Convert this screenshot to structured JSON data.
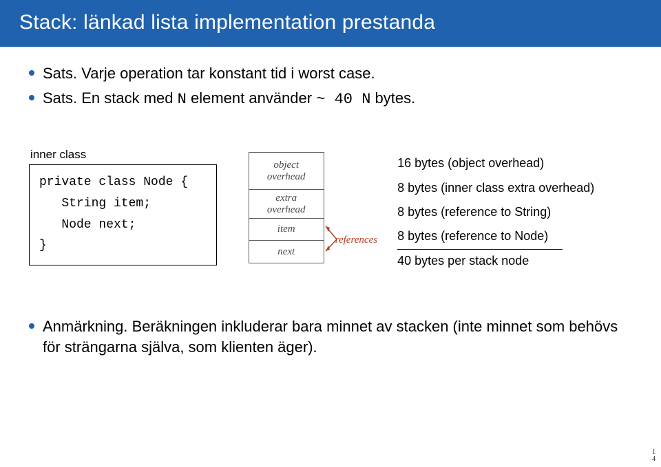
{
  "title": "Stack: länkad lista implementation prestanda",
  "bullets": {
    "b1_prefix": "Sats.",
    "b1_text": " Varje operation tar konstant tid i worst case.",
    "b2_prefix": "Sats.",
    "b2_text_a": " En stack med ",
    "b2_N1": "N",
    "b2_text_b": " element använder ",
    "b2_tilde": "~ 40 N",
    "b2_text_c": " bytes."
  },
  "code": {
    "inner_class_label": "inner class",
    "line1": "private class Node {",
    "line2": "   String item;",
    "line3": "   Node next;",
    "line4": "}"
  },
  "diagram": {
    "overhead": "object\noverhead",
    "extra": "extra\noverhead",
    "item": "item",
    "next": "next",
    "references": "references"
  },
  "memory": {
    "l1": "16 bytes (object overhead)",
    "l2": "8 bytes (inner class extra overhead)",
    "l3": "8 bytes (reference to String)",
    "l4": "8 bytes (reference to Node)",
    "total": "40 bytes per stack node"
  },
  "footer": {
    "prefix": "Anmärkning.",
    "text": " Beräkningen inkluderar bara minnet av stacken (inte minnet som behövs för strängarna själva, som klienten äger)."
  },
  "page_number_top": "1",
  "page_number_bottom": "4"
}
